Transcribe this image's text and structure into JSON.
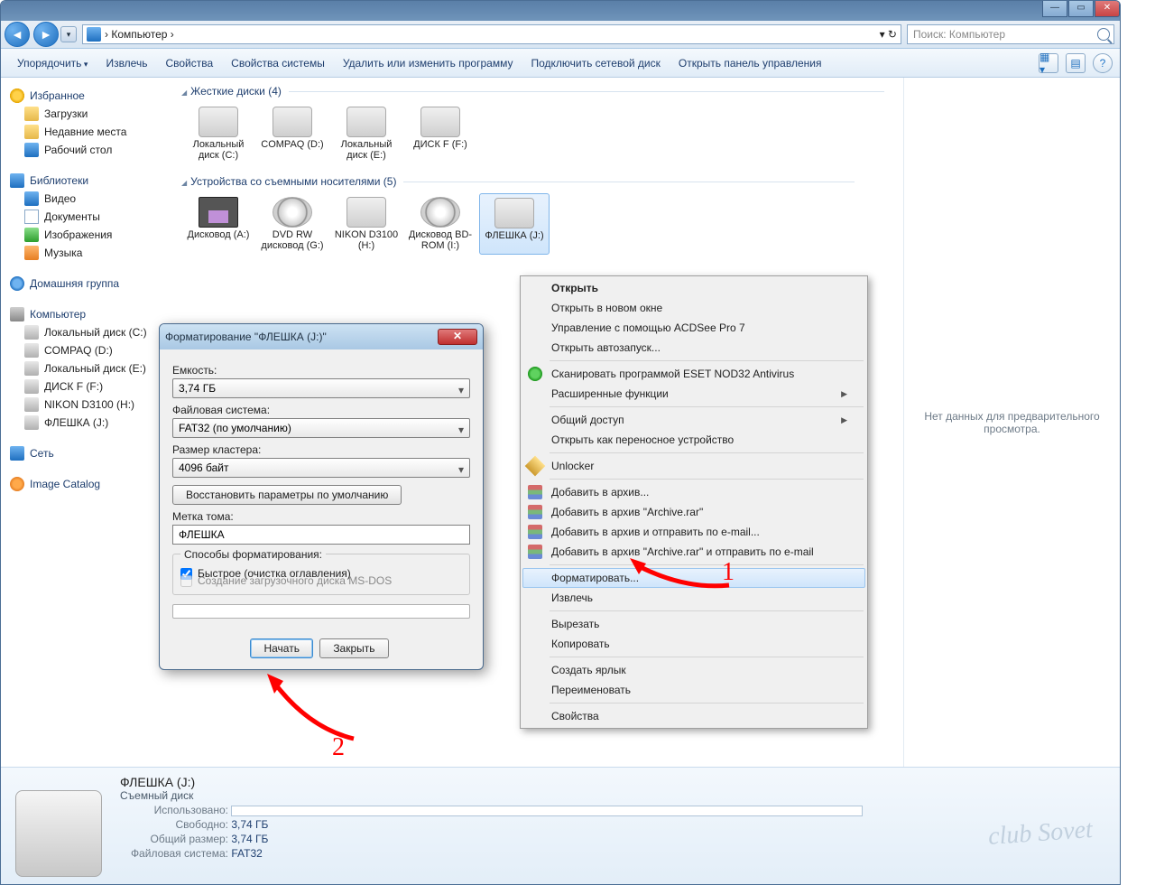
{
  "path": {
    "root": "Компьютер",
    "sep": "›"
  },
  "search": {
    "placeholder": "Поиск: Компьютер"
  },
  "toolbar": {
    "organize": "Упорядочить",
    "eject": "Извлечь",
    "properties": "Свойства",
    "sysprops": "Свойства системы",
    "uninstall": "Удалить или изменить программу",
    "mapdrive": "Подключить сетевой диск",
    "controlpanel": "Открыть панель управления"
  },
  "sidebar": {
    "favorites": "Избранное",
    "downloads": "Загрузки",
    "recent": "Недавние места",
    "desktop": "Рабочий стол",
    "libraries": "Библиотеки",
    "videos": "Видео",
    "documents": "Документы",
    "pictures": "Изображения",
    "music": "Музыка",
    "homegroup": "Домашняя группа",
    "computer": "Компьютер",
    "drvC": "Локальный диск (C:)",
    "drvD": "COMPAQ (D:)",
    "drvE": "Локальный диск (E:)",
    "drvF": "ДИСК F (F:)",
    "drvH": "NIKON D3100 (H:)",
    "drvJ": "ФЛЕШКА (J:)",
    "network": "Сеть",
    "catalog": "Image Catalog"
  },
  "sections": {
    "hdd": "Жесткие диски (4)",
    "removable": "Устройства со съемными носителями (5)"
  },
  "drives": {
    "c": "Локальный диск (C:)",
    "d": "COMPAQ (D:)",
    "e": "Локальный диск (E:)",
    "f": "ДИСК F (F:)",
    "a": "Дисковод (A:)",
    "g": "DVD RW дисковод (G:)",
    "h": "NIKON D3100 (H:)",
    "i": "Дисковод BD-ROM (I:)",
    "j": "ФЛЕШКА (J:)"
  },
  "preview": {
    "empty": "Нет данных для предварительного просмотра."
  },
  "context": {
    "open": "Открыть",
    "openNew": "Открыть в новом окне",
    "acdsee": "Управление с помощью ACDSee Pro 7",
    "autoplay": "Открыть автозапуск...",
    "eset": "Сканировать программой ESET NOD32 Antivirus",
    "advanced": "Расширенные функции",
    "share": "Общий доступ",
    "portable": "Открыть как переносное устройство",
    "unlocker": "Unlocker",
    "arc1": "Добавить в архив...",
    "arc2": "Добавить в архив \"Archive.rar\"",
    "arc3": "Добавить в архив и отправить по e-mail...",
    "arc4": "Добавить в архив \"Archive.rar\" и отправить по e-mail",
    "format": "Форматировать...",
    "eject": "Извлечь",
    "cut": "Вырезать",
    "copy": "Копировать",
    "shortcut": "Создать ярлык",
    "rename": "Переименовать",
    "props": "Свойства"
  },
  "dialog": {
    "title": "Форматирование \"ФЛЕШКА (J:)\"",
    "capacity_lbl": "Емкость:",
    "capacity_val": "3,74 ГБ",
    "fs_lbl": "Файловая система:",
    "fs_val": "FAT32 (по умолчанию)",
    "cluster_lbl": "Размер кластера:",
    "cluster_val": "4096 байт",
    "restore": "Восстановить параметры по умолчанию",
    "label_lbl": "Метка тома:",
    "label_val": "ФЛЕШКА",
    "methods": "Способы форматирования:",
    "quick": "Быстрое (очистка оглавления)",
    "msdos": "Создание загрузочного диска MS-DOS",
    "start": "Начать",
    "close": "Закрыть"
  },
  "status": {
    "name": "ФЛЕШКА (J:)",
    "type": "Съемный диск",
    "used_lbl": "Использовано:",
    "free_lbl": "Свободно:",
    "free_val": "3,74 ГБ",
    "total_lbl": "Общий размер:",
    "total_val": "3,74 ГБ",
    "fs_lbl": "Файловая система:",
    "fs_val": "FAT32"
  },
  "annotations": {
    "n1": "1",
    "n2": "2"
  },
  "watermark": "club Sovet"
}
